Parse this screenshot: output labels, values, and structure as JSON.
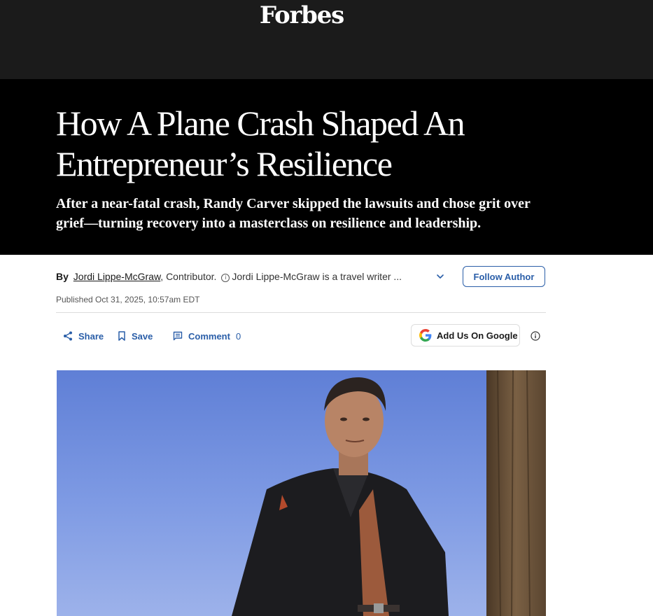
{
  "header": {
    "logo": "Forbes"
  },
  "hero": {
    "headline": "How A Plane Crash Shaped An Entrepreneur’s Resilience",
    "dek": "After a near-fatal crash, Randy Carver skipped the lawsuits and chose grit over grief—turning recovery into a masterclass on resilience and leadership."
  },
  "byline": {
    "by_label": "By",
    "author_name": "Jordi Lippe-McGraw",
    "role": ", Contributor.",
    "bio_snippet": "Jordi Lippe-McGraw is a travel writer ...",
    "follow_label": "Follow Author",
    "published": "Published Oct 31, 2025, 10:57am EDT"
  },
  "actions": {
    "share_label": "Share",
    "save_label": "Save",
    "comment_label": "Comment",
    "comment_count": "0",
    "google_label": "Add Us On Google"
  },
  "icons": {
    "share": "share-icon",
    "save": "bookmark-icon",
    "comment": "comment-icon",
    "google": "google-logo-icon",
    "info": "info-icon",
    "expand": "chevron-down-icon"
  },
  "colors": {
    "topbar": "#1b1b1b",
    "hero": "#000000",
    "accent": "#2a5ea8"
  }
}
